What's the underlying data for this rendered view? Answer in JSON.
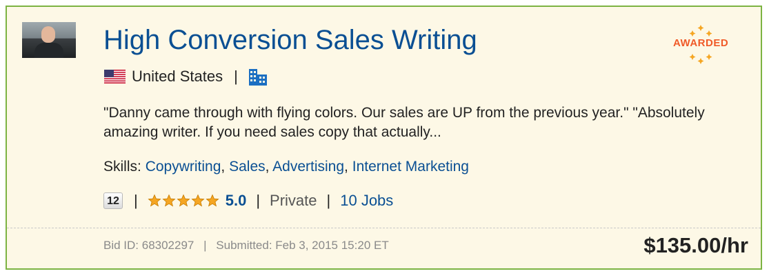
{
  "project": {
    "title": "High Conversion Sales Writing",
    "country": "United States",
    "description": "\"Danny came through with flying colors. Our sales are UP from the previous year.\" \"Absolutely amazing writer. If you need sales copy that actually...",
    "skills_label": "Skills:",
    "skills": [
      "Copywriting",
      "Sales",
      "Advertising",
      "Internet Marketing"
    ],
    "badge_count": "12",
    "rating": "5.0",
    "rating_stars": 5,
    "visibility": "Private",
    "jobs": "10 Jobs",
    "bid_id": "Bid ID: 68302297",
    "submitted": "Submitted: Feb 3, 2015 15:20 ET",
    "price": "$135.00/hr",
    "awarded_label": "AWARDED",
    "separator": "|",
    "skill_separator": ","
  },
  "icons": {
    "flag": "us-flag-icon",
    "building": "building-icon",
    "star": "star-icon"
  },
  "colors": {
    "link": "#0a4f93",
    "border": "#7cb342",
    "background": "#fdf8e6",
    "awarded": "#f05a28",
    "star": "#f5a623"
  }
}
